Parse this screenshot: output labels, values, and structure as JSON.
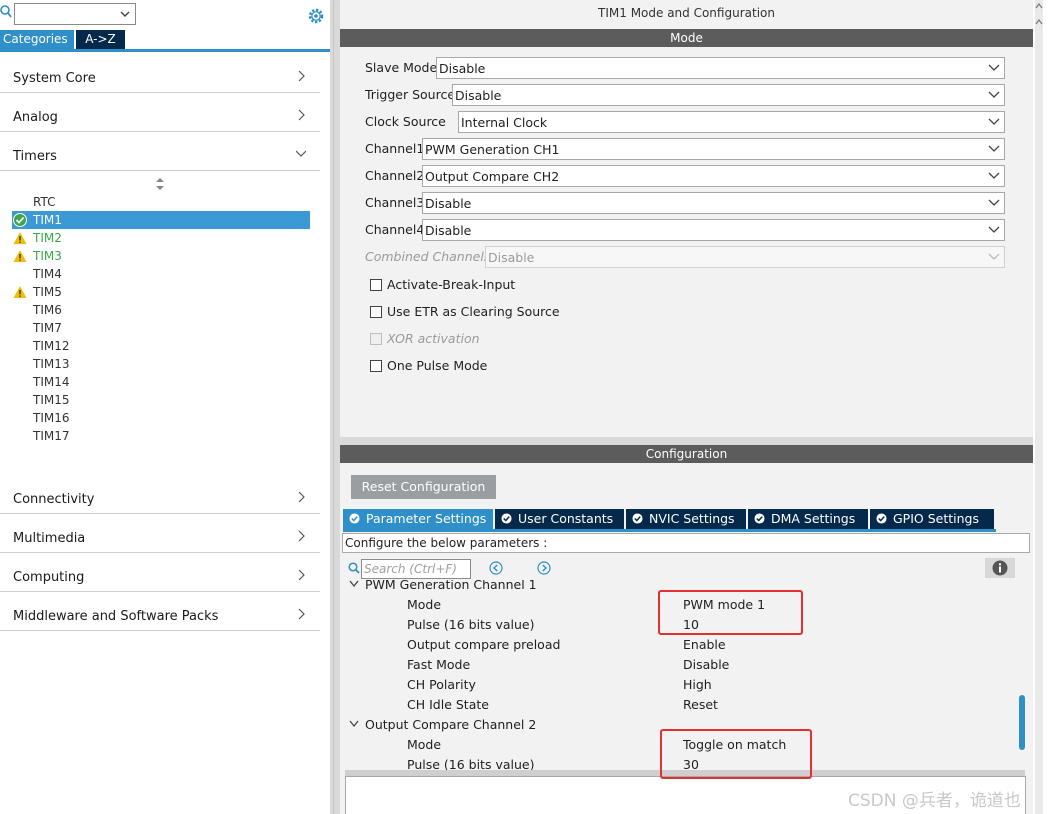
{
  "left": {
    "search": {
      "value": ""
    },
    "tabs": {
      "categories": "Categories",
      "az": "A->Z"
    },
    "categories": [
      {
        "label": "System Core",
        "state": "collapsed"
      },
      {
        "label": "Analog",
        "state": "collapsed"
      },
      {
        "label": "Timers",
        "state": "expanded"
      },
      {
        "label": "Connectivity",
        "state": "collapsed"
      },
      {
        "label": "Multimedia",
        "state": "collapsed"
      },
      {
        "label": "Computing",
        "state": "collapsed"
      },
      {
        "label": "Middleware and Software Packs",
        "state": "collapsed"
      }
    ],
    "timers": [
      {
        "label": "RTC",
        "status": "none"
      },
      {
        "label": "TIM1",
        "status": "ok"
      },
      {
        "label": "TIM2",
        "status": "warning"
      },
      {
        "label": "TIM3",
        "status": "warning"
      },
      {
        "label": "TIM4",
        "status": "none"
      },
      {
        "label": "TIM5",
        "status": "warning"
      },
      {
        "label": "TIM6",
        "status": "none"
      },
      {
        "label": "TIM7",
        "status": "none"
      },
      {
        "label": "TIM12",
        "status": "none"
      },
      {
        "label": "TIM13",
        "status": "none"
      },
      {
        "label": "TIM14",
        "status": "none"
      },
      {
        "label": "TIM15",
        "status": "none"
      },
      {
        "label": "TIM16",
        "status": "none"
      },
      {
        "label": "TIM17",
        "status": "none"
      }
    ]
  },
  "mode_panel": {
    "title": "TIM1 Mode and Configuration",
    "section": "Mode",
    "fields": [
      {
        "label": "Slave Mode",
        "value": "Disable"
      },
      {
        "label": "Trigger Source",
        "value": "Disable"
      },
      {
        "label": "Clock Source",
        "value": "Internal Clock"
      },
      {
        "label": "Channel1",
        "value": "PWM Generation CH1"
      },
      {
        "label": "Channel2",
        "value": "Output Compare CH2"
      },
      {
        "label": "Channel3",
        "value": "Disable"
      },
      {
        "label": "Channel4",
        "value": "Disable"
      },
      {
        "label": "Combined Channels",
        "value": "Disable"
      }
    ],
    "checkboxes": [
      {
        "label": "Activate-Break-Input",
        "checked": false
      },
      {
        "label": "Use ETR as Clearing Source",
        "checked": false
      },
      {
        "label": "XOR activation",
        "checked": false
      },
      {
        "label": "One Pulse Mode",
        "checked": false
      }
    ]
  },
  "config_panel": {
    "section": "Configuration",
    "reset_label": "Reset Configuration",
    "tabs": [
      {
        "label": "Parameter Settings",
        "active": true
      },
      {
        "label": "User Constants",
        "active": false
      },
      {
        "label": "NVIC Settings",
        "active": false
      },
      {
        "label": "DMA Settings",
        "active": false
      },
      {
        "label": "GPIO Settings",
        "active": false
      }
    ],
    "header_text": "Configure the below parameters :",
    "search_placeholder": "Search (Ctrl+F)",
    "rows": [
      {
        "group": true,
        "name": "PWM Generation Channel 1"
      },
      {
        "name": "Mode",
        "value": "PWM mode 1"
      },
      {
        "name": "Pulse (16 bits value)",
        "value": "10"
      },
      {
        "name": "Output compare preload",
        "value": "Enable"
      },
      {
        "name": "Fast Mode",
        "value": "Disable"
      },
      {
        "name": "CH Polarity",
        "value": "High"
      },
      {
        "name": "CH Idle State",
        "value": "Reset"
      },
      {
        "group": true,
        "name": "Output Compare Channel 2"
      },
      {
        "name": "Mode",
        "value": "Toggle on match"
      },
      {
        "name": "Pulse (16 bits value)",
        "value": "30"
      }
    ]
  },
  "watermark": "CSDN @兵者，诡道也",
  "colors": {
    "accent": "#2f8fc8",
    "dark_tab": "#04294b",
    "bar": "#5c5c5c",
    "panel_bg": "#f2f2f2",
    "highlight": "#e03030",
    "warning": "#f0c000",
    "ok": "#3aa84a"
  }
}
